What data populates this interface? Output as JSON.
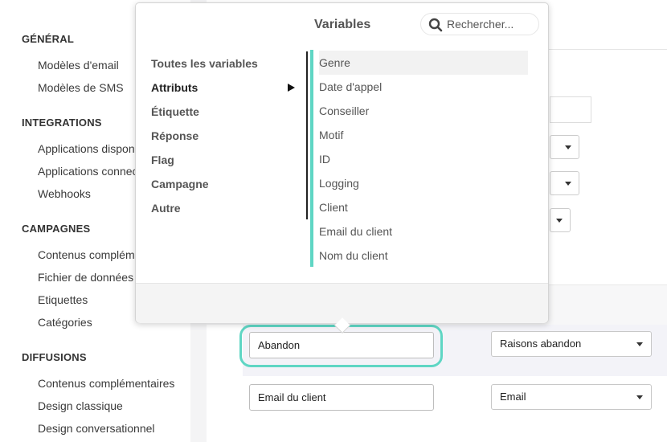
{
  "sidebar": {
    "sections": [
      {
        "title": "GÉNÉRAL",
        "items": [
          "Modèles d'email",
          "Modèles de SMS"
        ]
      },
      {
        "title": "INTEGRATIONS",
        "items": [
          "Applications disponibles",
          "Applications connectées",
          "Webhooks"
        ]
      },
      {
        "title": "CAMPAGNES",
        "items": [
          "Contenus complémentaires",
          "Fichier de données",
          "Etiquettes",
          "Catégories"
        ]
      },
      {
        "title": "DIFFUSIONS",
        "items": [
          "Contenus complémentaires",
          "Design classique",
          "Design conversationnel"
        ]
      }
    ]
  },
  "popover": {
    "title": "Variables",
    "search_placeholder": "Rechercher...",
    "categories": [
      "Toutes les variables",
      "Attributs",
      "Étiquette",
      "Réponse",
      "Flag",
      "Campagne",
      "Autre"
    ],
    "active_category": "Attributs",
    "variables": [
      "Genre",
      "Date d'appel",
      "Conseiller",
      "Motif",
      "ID",
      "Logging",
      "Client",
      "Email du client",
      "Nom du client"
    ],
    "selected_variable": "Genre"
  },
  "table": {
    "header_partial": "ant",
    "rows": [
      {
        "field": "Abandon",
        "select": "Raisons abandon"
      },
      {
        "field": "Email du client",
        "select": "Email"
      }
    ]
  },
  "colors": {
    "accent": "#5fd6c4"
  }
}
